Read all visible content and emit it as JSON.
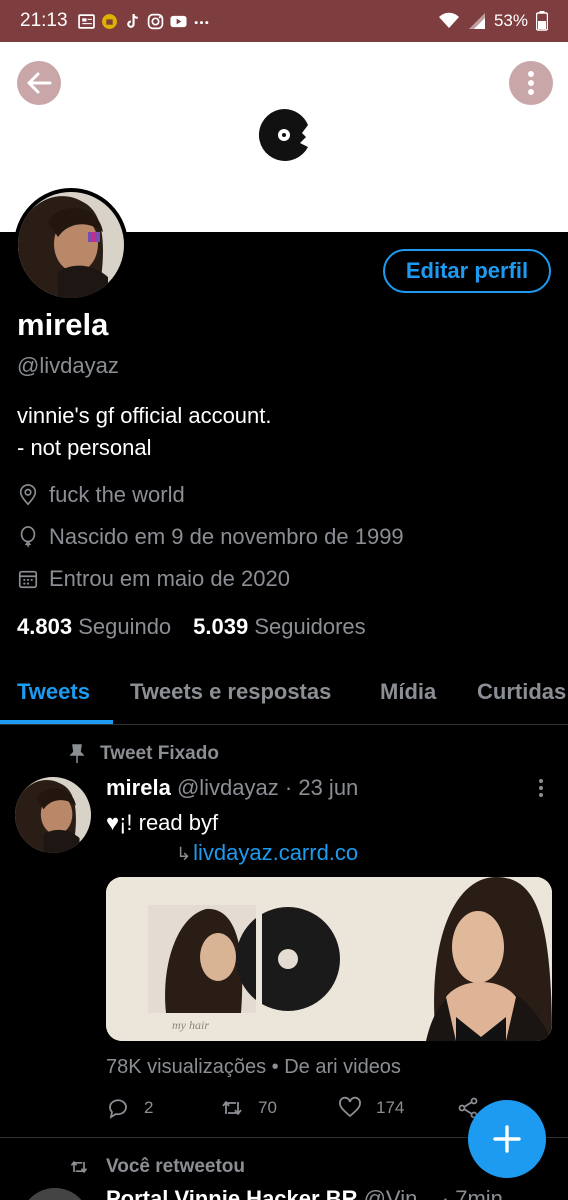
{
  "status_bar": {
    "time": "21:13",
    "battery": "53%",
    "icons": [
      "news-icon",
      "bag-icon",
      "tiktok-icon",
      "instagram-icon",
      "youtube-icon",
      "more-dots-icon"
    ]
  },
  "header": {
    "back_icon": "arrow-left-icon",
    "more_icon": "more-vertical-icon"
  },
  "profile": {
    "name": "mirela",
    "handle": "@livdayaz",
    "bio_line1": "vinnie's gf official account.",
    "bio_line2": "- not personal",
    "location": "fuck the world",
    "birthday": "Nascido em 9 de novembro de 1999",
    "joined": "Entrou em maio de 2020",
    "following_count": "4.803",
    "following_label": "Seguindo",
    "followers_count": "5.039",
    "followers_label": "Seguidores",
    "edit_button": "Editar perfil"
  },
  "tabs": [
    {
      "label": "Tweets",
      "active": true
    },
    {
      "label": "Tweets e respostas",
      "active": false
    },
    {
      "label": "Mídia",
      "active": false
    },
    {
      "label": "Curtidas",
      "active": false
    }
  ],
  "pinned_tweet": {
    "pinned_label": "Tweet Fixado",
    "name": "mirela",
    "handle": "@livdayaz",
    "date": "· 23 jun",
    "text": "♥¡! read byf",
    "link_arrow": "↳",
    "link": "livdayaz.carrd.co",
    "media_caption": "my hair",
    "views": "78K visualizações",
    "source": "• De ari videos",
    "replies": "2",
    "retweets": "70",
    "likes": "174"
  },
  "next_tweet": {
    "retweet_label": "Você retweetou",
    "name": "Portal Vinnie Hacker BR",
    "handle": "@Vin...",
    "time": "· 7min"
  },
  "colors": {
    "accent": "#1d9bf0",
    "status_bar": "#7e3e40",
    "secondary_text": "#8b8f94"
  }
}
